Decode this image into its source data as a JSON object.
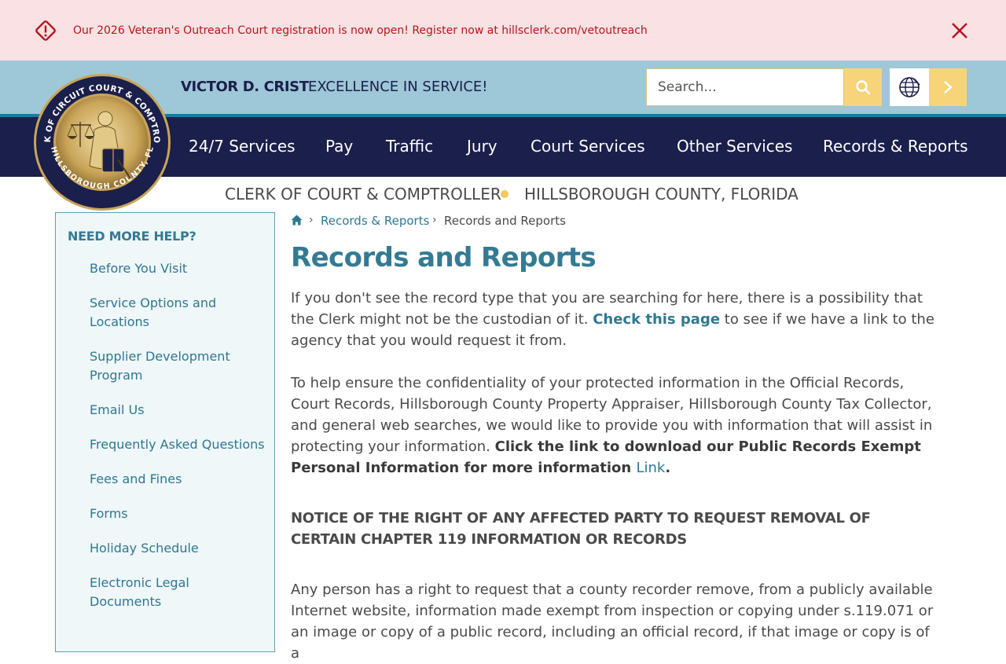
{
  "alert": {
    "message": "Our 2026 Veteran's Outreach Court registration is now open! Register now at hillsclerk.com/vetoutreach",
    "icon": "alert-diamond-icon",
    "close_icon": "close-icon",
    "color": "#b4161b"
  },
  "header": {
    "name": "VICTOR D. CRIST",
    "tagline": "EXCELLENCE IN SERVICE!",
    "search_placeholder": "Search...",
    "brand_navy": "#1b1f4b",
    "brand_gold": "#f7d47a"
  },
  "nav": {
    "items": [
      "24/7 Services",
      "Pay",
      "Traffic",
      "Jury",
      "Court Services",
      "Other Services",
      "Records & Reports"
    ]
  },
  "seal": {
    "top_text": "CLERK OF CIRCUIT COURT & COMPTROLLER",
    "bottom_text": "HILLSBOROUGH COUNTY, FL"
  },
  "subtitle": {
    "left": "CLERK OF COURT & COMPTROLLER",
    "right": "HILLSBOROUGH COUNTY, FLORIDA"
  },
  "sidebar": {
    "title": "NEED MORE HELP?",
    "items": [
      "Before You Visit",
      "Service Options and Locations",
      "Supplier Development Program",
      "Email Us",
      "Frequently Asked Questions",
      "Fees and Fines",
      "Forms",
      "Holiday Schedule",
      "Electronic Legal Documents"
    ]
  },
  "breadcrumb": {
    "separator": "›",
    "link": "Records & Reports",
    "current": "Records and Reports"
  },
  "content": {
    "title": "Records and Reports",
    "p1_before": "If you don't see the record type that you are searching for here, there is a possibility that the Clerk might not be the custodian of it. ",
    "p1_link": "Check this page",
    "p1_after": " to see if we have a link to the agency that you would request it from.",
    "p2_text": "To help ensure the confidentiality of your protected information in the Official Records, Court Records, Hillsborough County Property Appraiser, Hillsborough County Tax Collector, and general web searches, we would like to provide you with information that will assist in protecting your information. ",
    "p2_bold": "Click the link to download our Public Records Exempt Personal Information for more information ",
    "p2_link": "Link",
    "p2_end": ".",
    "notice": "NOTICE OF THE RIGHT OF ANY AFFECTED PARTY TO REQUEST REMOVAL OF CERTAIN CHAPTER 119 INFORMATION OR RECORDS",
    "p3": "Any person has a right to request that a county recorder remove, from a publicly available Internet website, information made exempt from inspection or copying under s.119.071 or an image or copy of a public record, including an official record, if that image or copy is of a"
  }
}
